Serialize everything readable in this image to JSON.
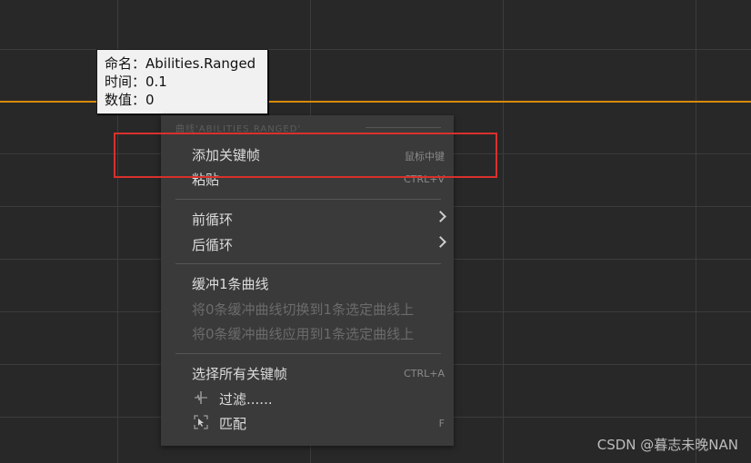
{
  "tooltip": {
    "name_line": "命名：Abilities.Ranged",
    "time_line": "时间：0.1",
    "value_line": "数值：0"
  },
  "menu": {
    "section_header": "曲线'ABILITIES.RANGED'",
    "add_key": {
      "label": "添加关键帧",
      "shortcut": "鼠标中键"
    },
    "paste": {
      "label": "粘贴",
      "shortcut": "CTRL+V"
    },
    "pre_infinity": {
      "label": "前循环"
    },
    "post_infinity": {
      "label": "后循环"
    },
    "buffer_curve": {
      "label": "缓冲1条曲线"
    },
    "swap_buffered": {
      "label": "将0条缓冲曲线切换到1条选定曲线上"
    },
    "apply_buffered": {
      "label": "将0条缓冲曲线应用到1条选定曲线上"
    },
    "select_all_keys": {
      "label": "选择所有关键帧",
      "shortcut": "CTRL+A"
    },
    "filter": {
      "label": "过滤......",
      "icon": "filter-icon"
    },
    "fit": {
      "label": "匹配",
      "shortcut": "F",
      "icon": "fit-icon"
    }
  },
  "watermark": "CSDN @暮志未晚NAN",
  "colors": {
    "curve": "#d98a0b",
    "highlight": "#d9302c",
    "background": "#282828",
    "menu_bg": "#3a3a3a"
  }
}
